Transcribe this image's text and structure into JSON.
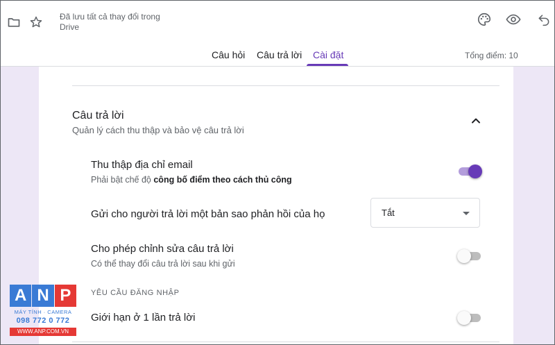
{
  "header": {
    "saved_status": "Đã lưu tất cả thay đổi trong Drive",
    "tabs": [
      {
        "label": "Câu hỏi"
      },
      {
        "label": "Câu trả lời"
      },
      {
        "label": "Cài đặt"
      }
    ],
    "active_tab": "Cài đặt",
    "total_points": "Tổng điểm: 10"
  },
  "responses_section": {
    "title": "Câu trả lời",
    "subtitle": "Quản lý cách thu thập và bảo vệ câu trả lời",
    "expanded": true
  },
  "settings": {
    "collect_email": {
      "label": "Thu thập địa chỉ email",
      "sub_prefix": "Phải bật chế độ ",
      "sub_bold": "công bố điểm theo cách thủ công",
      "enabled": true
    },
    "send_copy": {
      "label": "Gửi cho người trả lời một bản sao phản hồi của họ",
      "value": "Tắt"
    },
    "allow_edit": {
      "label": "Cho phép chỉnh sửa câu trả lời",
      "sub": "Có thể thay đổi câu trả lời sau khi gửi",
      "enabled": false
    },
    "login_heading": "YÊU CẦU ĐĂNG NHẬP",
    "limit_one": {
      "label": "Giới hạn ở 1 lần trả lời",
      "enabled": false
    }
  },
  "watermark": {
    "letters": [
      "A",
      "N",
      "P"
    ],
    "tagline": "MÁY TÍNH · CAMERA",
    "phone": "098 772 0 772",
    "url": "WWW.ANP.COM.VN"
  },
  "colors": {
    "accent": "#673ab7",
    "page_background": "#ede7f6",
    "watermark_letter_bg": [
      "#3a7bd5",
      "#3a7bd5",
      "#e53935"
    ]
  }
}
